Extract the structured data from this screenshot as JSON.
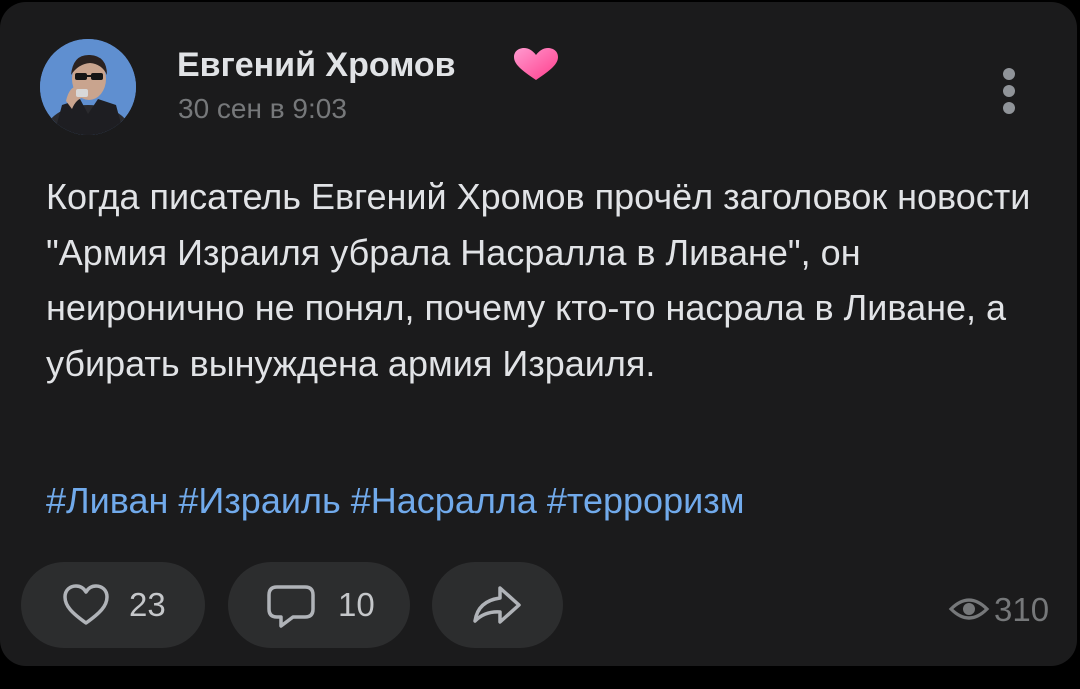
{
  "post": {
    "author": {
      "name": "Евгений Хромов",
      "avatar_icon": "user-photo-avatar",
      "badge_icon": "pink-heart-icon",
      "badge_color": "#ff5c9e"
    },
    "date": "30 сен в 9:03",
    "more_icon": "vertical-dots-icon",
    "text": "Когда писатель Евгений Хромов прочёл заголовок новости \"Армия Израиля убрала Насралла в Ливане\", он неиронично не понял, почему кто-то насрала в Ливане, а убирать вынуждена армия Израиля.",
    "hashtags": [
      "#Ливан",
      "#Израиль",
      "#Насралла",
      "#терроризм"
    ],
    "hashtag_color": "#71aaeb"
  },
  "actions": {
    "like": {
      "icon": "heart-outline-icon",
      "count": "23"
    },
    "comment": {
      "icon": "comment-bubble-icon",
      "count": "10"
    },
    "share": {
      "icon": "share-arrow-icon"
    }
  },
  "views": {
    "icon": "eye-icon",
    "count": "310"
  },
  "colors": {
    "background": "#000000",
    "card": "#1b1b1c",
    "action_button": "#2c2d2e",
    "text_primary": "#e1e3e6",
    "text_secondary": "#76787a"
  }
}
